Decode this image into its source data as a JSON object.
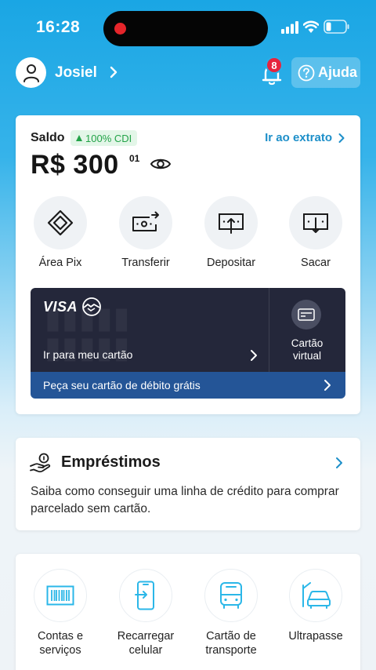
{
  "status_bar": {
    "time": "16:28"
  },
  "header": {
    "user_name": "Josiel",
    "notification_count": "8",
    "help_label": "Ajuda"
  },
  "balance": {
    "label": "Saldo",
    "cdi_badge": "100% CDI",
    "statement_link": "Ir ao extrato",
    "amount": "R$ 300",
    "cents": "01"
  },
  "actions": [
    {
      "label": "Área Pix",
      "icon": "pix-icon"
    },
    {
      "label": "Transferir",
      "icon": "transfer-icon"
    },
    {
      "label": "Depositar",
      "icon": "deposit-icon"
    },
    {
      "label": "Sacar",
      "icon": "withdraw-icon"
    }
  ],
  "card_section": {
    "brand": "VISA",
    "my_card_link": "Ir para meu cartão",
    "virtual_card_label": "Cartão virtual",
    "debit_offer": "Peça seu cartão de débito grátis"
  },
  "loans": {
    "title": "Empréstimos",
    "description": "Saiba como conseguir uma linha de crédito para comprar parcelado sem cartão."
  },
  "services": [
    {
      "label": "Contas e serviços",
      "icon": "barcode-icon"
    },
    {
      "label": "Recarregar celular",
      "icon": "phone-recharge-icon"
    },
    {
      "label": "Cartão de transporte",
      "icon": "bus-icon"
    },
    {
      "label": "Ultrapasse",
      "icon": "car-toll-icon"
    }
  ],
  "colors": {
    "brand_blue": "#1aa6e4",
    "link_blue": "#1d8fc9",
    "card_dark": "#24273a",
    "debit_bar": "#245597",
    "badge_red": "#e6243e",
    "cdi_green": "#23a348",
    "service_icon": "#2bb7e8"
  }
}
